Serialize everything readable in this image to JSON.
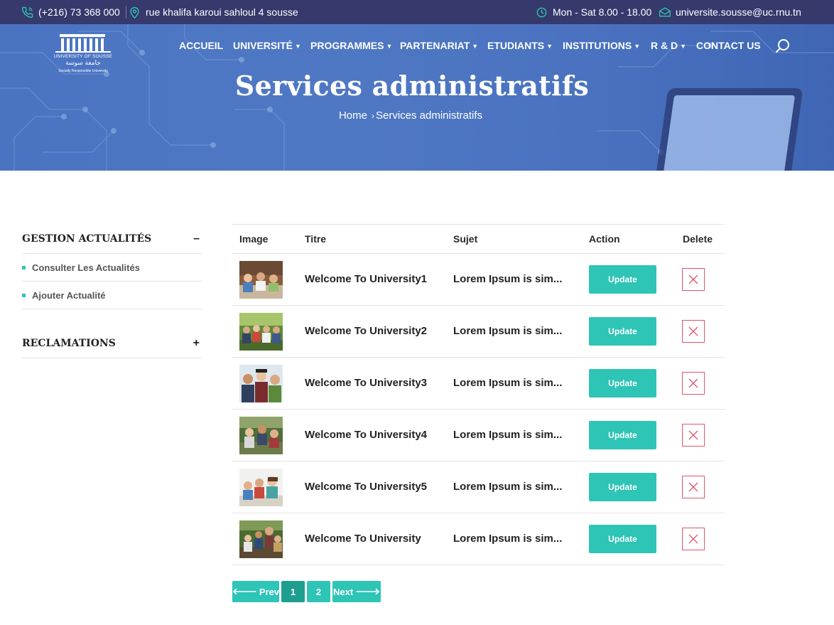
{
  "topbar": {
    "phone": "(+216) 73 368 000",
    "address": "rue khalifa karoui sahloul 4 sousse",
    "hours": "Mon - Sat 8.00 - 18.00",
    "email": "universite.sousse@uc.rnu.tn"
  },
  "logo": {
    "name": "UNIVERSITY OF SOUSSE",
    "arabic": "جامعة سوسة",
    "tagline": "Socially Responsible University"
  },
  "nav": {
    "items": [
      {
        "label": "ACCUEIL",
        "dropdown": false
      },
      {
        "label": "UNIVERSITÉ",
        "dropdown": true
      },
      {
        "label": "PROGRAMMES",
        "dropdown": true
      },
      {
        "label": "PARTENARIAT",
        "dropdown": true
      },
      {
        "label": "ETUDIANTS",
        "dropdown": true
      },
      {
        "label": "INSTITUTIONS",
        "dropdown": true
      },
      {
        "label": "R & D",
        "dropdown": true
      },
      {
        "label": "CONTACT US",
        "dropdown": false
      }
    ],
    "search_icon": "search-icon"
  },
  "hero": {
    "title": "Services administratifs",
    "breadcrumb": {
      "home": "Home",
      "separator": "›",
      "current": "Services administratifs"
    }
  },
  "sidebar": {
    "sections": [
      {
        "title": "GESTION ACTUALITÉS",
        "toggle": "–",
        "links": [
          "Consulter Les Actualités",
          "Ajouter Actualité"
        ]
      },
      {
        "title": "RECLAMATIONS",
        "toggle": "+",
        "links": []
      }
    ]
  },
  "table": {
    "headers": {
      "image": "Image",
      "title": "Titre",
      "subject": "Sujet",
      "action": "Action",
      "delete": "Delete"
    },
    "rows": [
      {
        "title": "Welcome To University1",
        "subject": "Lorem Ipsum is sim...",
        "action": "Update"
      },
      {
        "title": "Welcome To University2",
        "subject": "Lorem Ipsum is sim...",
        "action": "Update"
      },
      {
        "title": "Welcome To University3",
        "subject": "Lorem Ipsum is sim...",
        "action": "Update"
      },
      {
        "title": "Welcome To University4",
        "subject": "Lorem Ipsum is sim...",
        "action": "Update"
      },
      {
        "title": "Welcome To University5",
        "subject": "Lorem Ipsum is sim...",
        "action": "Update"
      },
      {
        "title": "Welcome To University",
        "subject": "Lorem Ipsum is sim...",
        "action": "Update"
      }
    ]
  },
  "pagination": {
    "prev": "Prev",
    "pages": [
      "1",
      "2"
    ],
    "current": "1",
    "next": "Next"
  },
  "colors": {
    "accent": "#2ec4b6",
    "topbar": "#36396b",
    "hero": "#4a74c1",
    "delete": "#e0556e"
  }
}
